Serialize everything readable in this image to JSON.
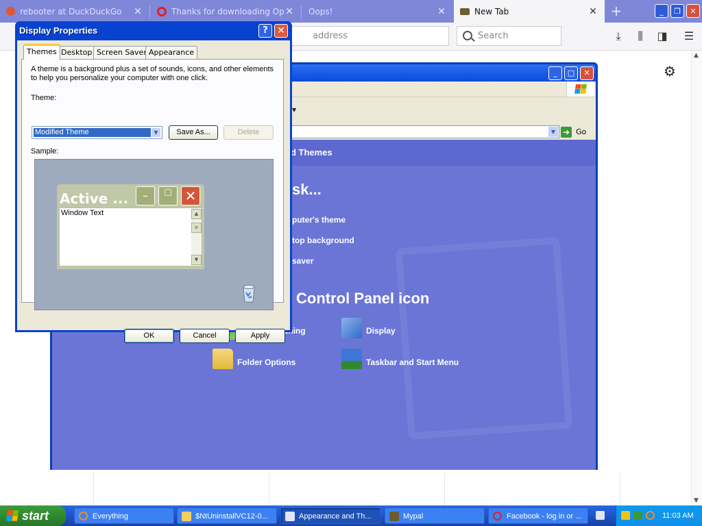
{
  "browser": {
    "tabs": [
      {
        "label": "rebooter at DuckDuckGo",
        "icon": "duckduckgo-icon",
        "active": false
      },
      {
        "label": "Thanks for downloading Opera",
        "icon": "opera-icon",
        "active": false
      },
      {
        "label": "Oops!",
        "icon": "",
        "active": false
      },
      {
        "label": "New Tab",
        "icon": "new-tab-icon",
        "active": true
      }
    ],
    "address_placeholder": "address",
    "search_placeholder": "Search"
  },
  "control_panel": {
    "banner_text": "d Themes",
    "pick_task_heading": "sk...",
    "tasks": [
      "puter's theme",
      "top background",
      "saver"
    ],
    "icon_heading": "Control Panel icon",
    "icons": [
      {
        "label": "ClearType Tuning",
        "icon": "cleartype-icon"
      },
      {
        "label": "Display",
        "icon": "display-icon"
      },
      {
        "label": "Folder Options",
        "icon": "folder-options-icon"
      },
      {
        "label": "Taskbar and Start Menu",
        "icon": "taskbar-icon"
      }
    ],
    "go_label": "Go"
  },
  "dialog": {
    "title": "Display Properties",
    "tabs": [
      "Themes",
      "Desktop",
      "Screen Saver",
      "Appearance"
    ],
    "description": "A theme is a background plus a set of sounds, icons, and other elements to help you personalize your computer with one click.",
    "theme_label": "Theme:",
    "theme_value": "Modified Theme",
    "save_as_label": "Save As...",
    "delete_label": "Delete",
    "sample_label": "Sample:",
    "sample_window_title": "Active ...",
    "sample_window_text": "Window Text",
    "ok_label": "OK",
    "cancel_label": "Cancel",
    "apply_label": "Apply"
  },
  "taskbar": {
    "start_label": "start",
    "tasks": [
      {
        "label": "Everything",
        "active": false
      },
      {
        "label": "$NtUninstallVC12-0...",
        "active": false
      },
      {
        "label": "Appearance and Th...",
        "active": true
      },
      {
        "label": "Mypal",
        "active": false
      },
      {
        "label": "Facebook - log in or ...",
        "active": false
      }
    ],
    "clock": "11:03 AM"
  }
}
